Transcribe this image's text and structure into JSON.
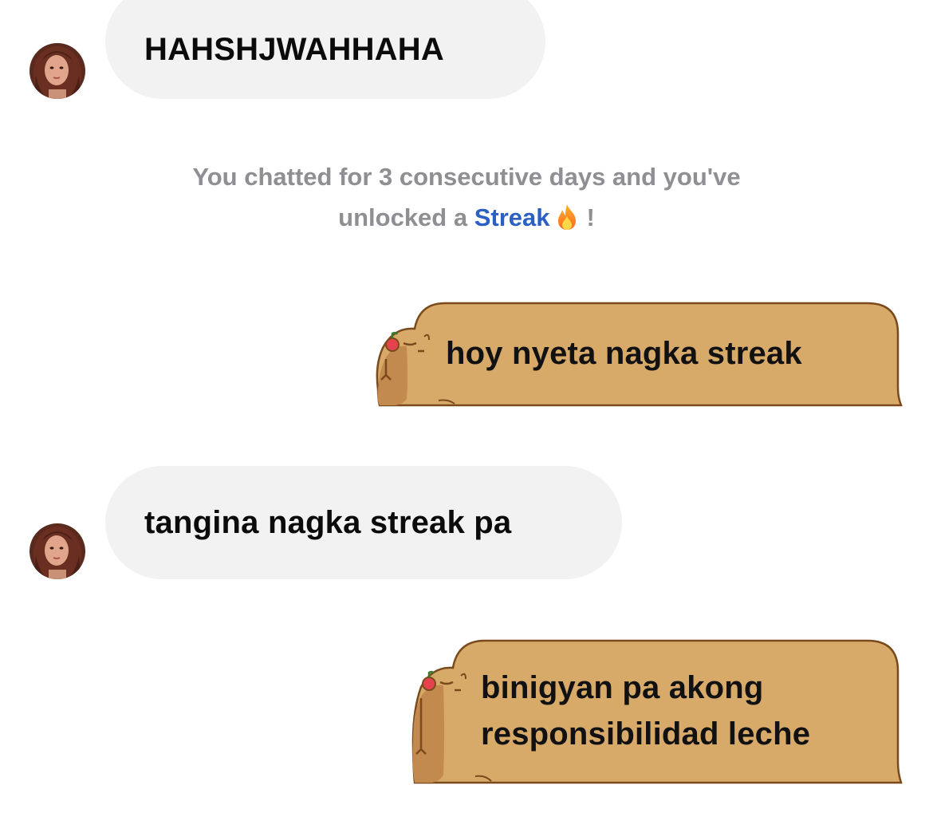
{
  "conversation": {
    "messages": [
      {
        "direction": "incoming",
        "text": "HAHSHJWAHHAHA"
      },
      {
        "direction": "outgoing",
        "text": "hoy nyeta nagka streak"
      },
      {
        "direction": "incoming",
        "text": "tangina nagka streak pa"
      },
      {
        "direction": "outgoing",
        "text_line1": "binigyan pa akong",
        "text_line2": "responsibilidad leche"
      }
    ],
    "streak_notice": {
      "line1": "You chatted for 3 consecutive days and you've",
      "line2_prefix": "unlocked a",
      "link_text": "Streak",
      "emoji": "fire-icon",
      "suffix": "!"
    }
  },
  "theme": {
    "incoming_bubble": "#f2f2f3",
    "outgoing_bubble_theme": "capybara",
    "capybara_fill": "#d8aa6a",
    "capybara_outline": "#7a4a1c",
    "link_color": "#2b5fc2",
    "system_text_color": "#8e8e93"
  }
}
